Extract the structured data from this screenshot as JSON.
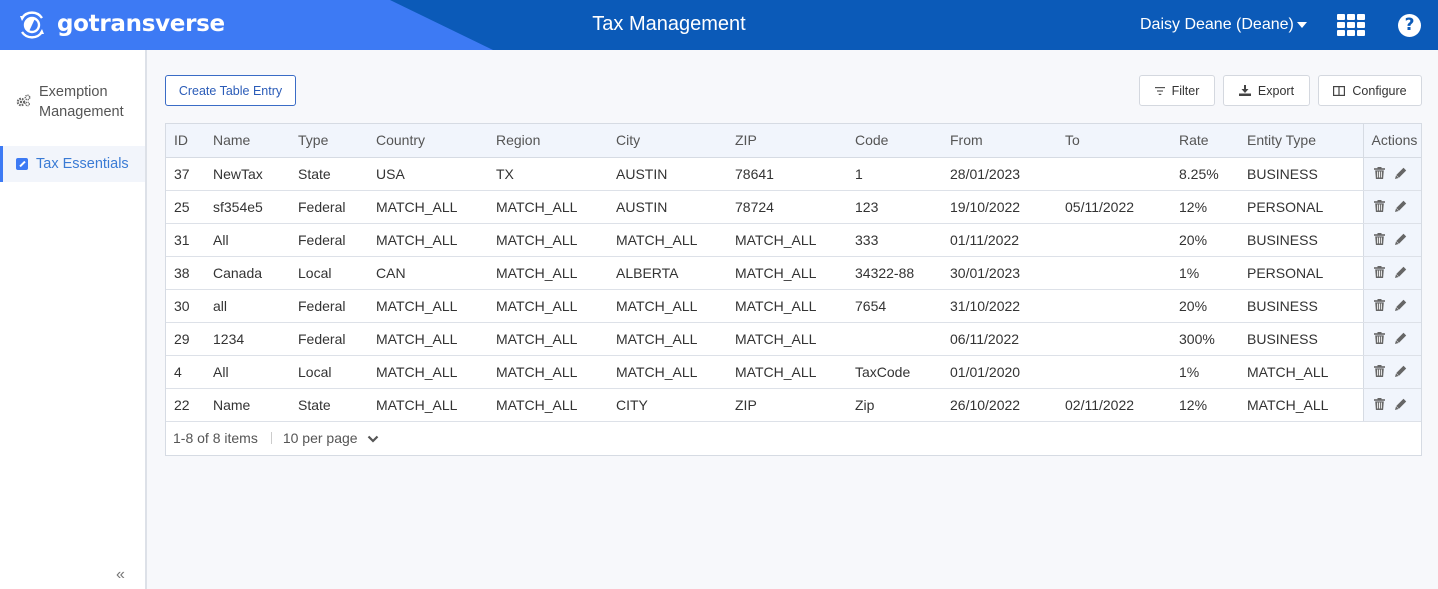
{
  "header": {
    "logo_text": "gotransverse",
    "title": "Tax Management",
    "user": "Daisy Deane (Deane)",
    "colors": {
      "primary": "#0b5ab8",
      "accent": "#3d7af4"
    }
  },
  "sidebar": {
    "items": [
      {
        "label": "Exemption Management",
        "icon": "gears-icon",
        "active": false
      },
      {
        "label": "Tax Essentials",
        "icon": "pencil-square-icon",
        "active": true
      }
    ],
    "collapse_label": "«"
  },
  "toolbar": {
    "create_label": "Create Table Entry",
    "filter_label": "Filter",
    "export_label": "Export",
    "configure_label": "Configure"
  },
  "table": {
    "columns": [
      "ID",
      "Name",
      "Type",
      "Country",
      "Region",
      "City",
      "ZIP",
      "Code",
      "From",
      "To",
      "Rate",
      "Entity Type",
      "Actions"
    ],
    "rows": [
      [
        "37",
        "NewTax",
        "State",
        "USA",
        "TX",
        "AUSTIN",
        "78641",
        "1",
        "28/01/2023",
        "",
        "8.25%",
        "BUSINESS"
      ],
      [
        "25",
        "sf354e5",
        "Federal",
        "MATCH_ALL",
        "MATCH_ALL",
        "AUSTIN",
        "78724",
        "123",
        "19/10/2022",
        "05/11/2022",
        "12%",
        "PERSONAL"
      ],
      [
        "31",
        "All",
        "Federal",
        "MATCH_ALL",
        "MATCH_ALL",
        "MATCH_ALL",
        "MATCH_ALL",
        "333",
        "01/11/2022",
        "",
        "20%",
        "BUSINESS"
      ],
      [
        "38",
        "Canada",
        "Local",
        "CAN",
        "MATCH_ALL",
        "ALBERTA",
        "MATCH_ALL",
        "34322-88",
        "30/01/2023",
        "",
        "1%",
        "PERSONAL"
      ],
      [
        "30",
        "all",
        "Federal",
        "MATCH_ALL",
        "MATCH_ALL",
        "MATCH_ALL",
        "MATCH_ALL",
        "7654",
        "31/10/2022",
        "",
        "20%",
        "BUSINESS"
      ],
      [
        "29",
        "1234",
        "Federal",
        "MATCH_ALL",
        "MATCH_ALL",
        "MATCH_ALL",
        "MATCH_ALL",
        "",
        "06/11/2022",
        "",
        "300%",
        "BUSINESS"
      ],
      [
        "4",
        "All",
        "Local",
        "MATCH_ALL",
        "MATCH_ALL",
        "MATCH_ALL",
        "MATCH_ALL",
        "TaxCode",
        "01/01/2020",
        "",
        "1%",
        "MATCH_ALL"
      ],
      [
        "22",
        "Name",
        "State",
        "MATCH_ALL",
        "MATCH_ALL",
        "CITY",
        "ZIP",
        "Zip",
        "26/10/2022",
        "02/11/2022",
        "12%",
        "MATCH_ALL"
      ]
    ],
    "row_actions": [
      "delete",
      "edit"
    ]
  },
  "pagination": {
    "summary": "1-8 of 8 items",
    "per_page": "10 per page"
  }
}
